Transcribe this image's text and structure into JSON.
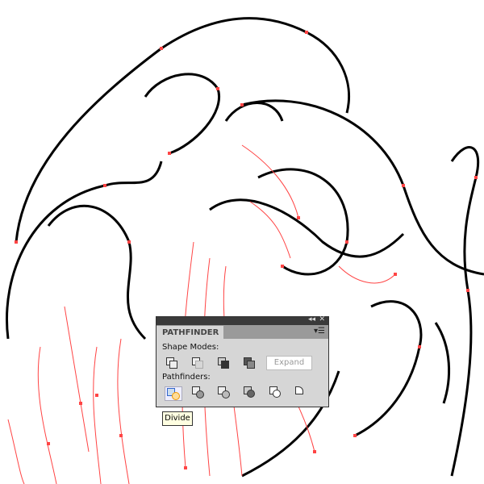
{
  "panel": {
    "title": "PATHFINDER",
    "shape_modes_label": "Shape Modes:",
    "pathfinders_label": "Pathfinders:",
    "expand_label": "Expand",
    "shape_modes": [
      "unite",
      "minus-front",
      "intersect",
      "exclude"
    ],
    "pathfinders": [
      "divide",
      "trim",
      "merge",
      "crop",
      "outline",
      "minus-back"
    ]
  },
  "tooltip": "Divide",
  "colors": {
    "anchor": "#ff4444",
    "stroke": "#000000"
  }
}
